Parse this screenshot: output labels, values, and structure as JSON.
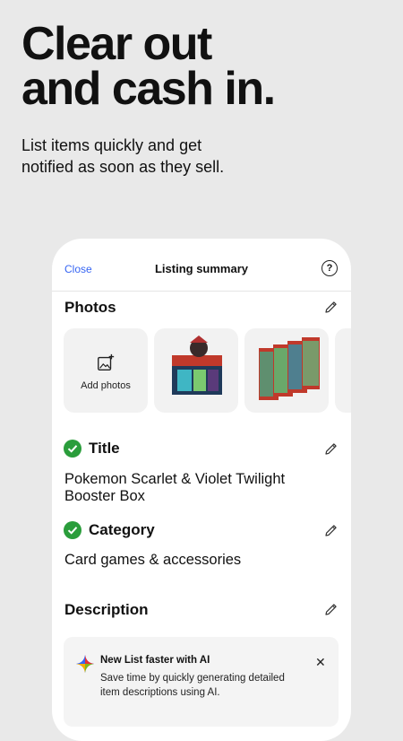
{
  "hero": {
    "headline_line1": "Clear out",
    "headline_line2": "and cash in.",
    "subtext_line1": "List items quickly and get",
    "subtext_line2": "notified as soon as they sell."
  },
  "listing": {
    "close_label": "Close",
    "title": "Listing summary",
    "help_symbol": "?"
  },
  "photos": {
    "heading": "Photos",
    "add_photos_label": "Add photos"
  },
  "title_section": {
    "heading": "Title",
    "value_line1": "Pokemon Scarlet & Violet Twilight",
    "value_line2": "Booster Box"
  },
  "category_section": {
    "heading": "Category",
    "value": "Card games & accessories"
  },
  "description_section": {
    "heading": "Description"
  },
  "ai_banner": {
    "title": "New List faster with AI",
    "body": "Save time by quickly generating detailed item descriptions using AI.",
    "close_symbol": "✕"
  },
  "colors": {
    "accent_link": "#3665f3",
    "check_green": "#2a9d3b",
    "background": "#e9e9e9"
  }
}
